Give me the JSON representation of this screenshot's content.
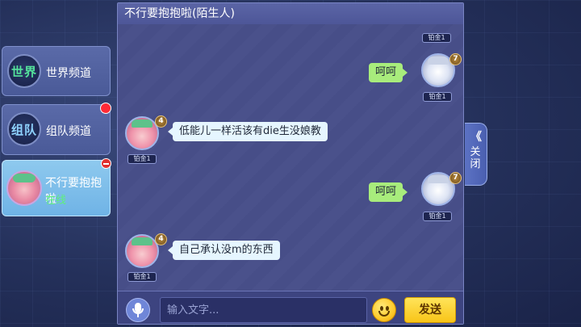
{
  "channels": [
    {
      "badge": "世界",
      "label": "世界频道",
      "has_notification": false
    },
    {
      "badge": "组队",
      "label": "组队频道",
      "has_notification": true
    }
  ],
  "active_contact": {
    "name": "不行要抱抱啦",
    "status": "在线",
    "status_color": "#5ef07a"
  },
  "chat": {
    "title": "不行要抱抱啦(陌生人)",
    "messages": [
      {
        "side": "right",
        "text": "",
        "level": "7",
        "rank": "铂金1",
        "partial": true
      },
      {
        "side": "right",
        "text": "呵呵",
        "level": "7",
        "rank": "铂金1"
      },
      {
        "side": "left",
        "text": "低能儿一样活该有die生没娘教",
        "level": "4",
        "rank": "铂金1"
      },
      {
        "side": "right",
        "text": "呵呵",
        "level": "7",
        "rank": "铂金1"
      },
      {
        "side": "left",
        "text": "自己承认没m的东西",
        "level": "4",
        "rank": "铂金1"
      }
    ]
  },
  "input": {
    "placeholder": "输入文字...",
    "value": ""
  },
  "buttons": {
    "send": "发送"
  },
  "close_tab": {
    "chevron": "《",
    "label": "关闭"
  },
  "colors": {
    "my_bubble": "#a8ec7c",
    "their_bubble": "#e6f6ff",
    "send_button": "#f8c418"
  }
}
